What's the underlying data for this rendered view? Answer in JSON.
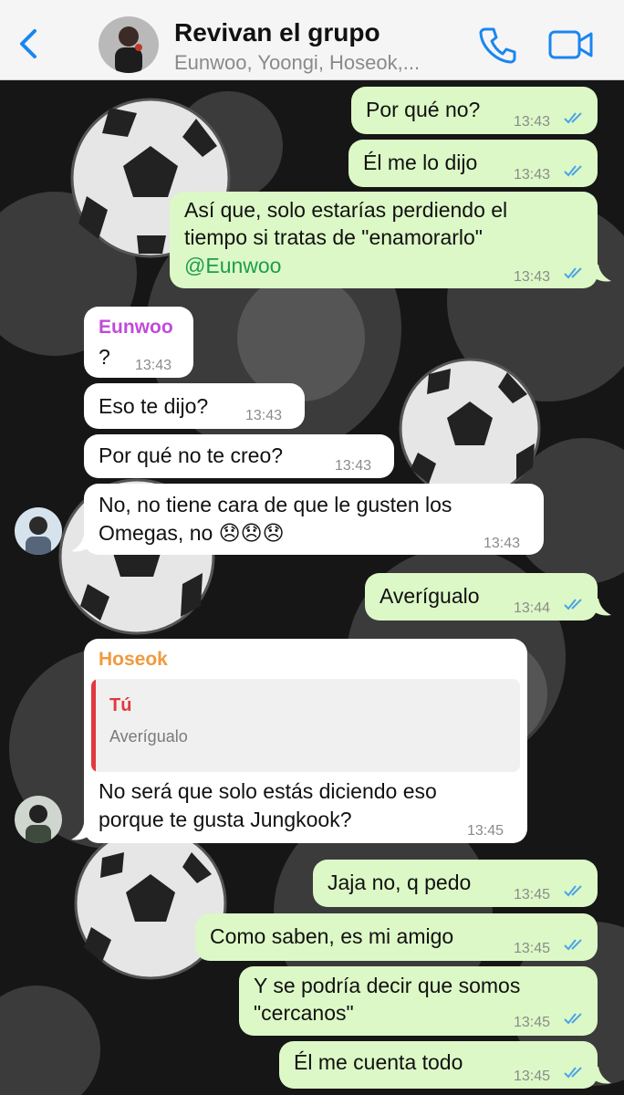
{
  "header": {
    "back_label": "back",
    "title": "Revivan el grupo",
    "subtitle": "Eunwoo, Yoongi, Hoseok,..."
  },
  "messages": [
    {
      "direction": "out",
      "text": "Por qué no?",
      "time": "13:43",
      "status": "read"
    },
    {
      "direction": "out",
      "text": "Él me lo dijo",
      "time": "13:43",
      "status": "read"
    },
    {
      "direction": "out",
      "line1": "Así que, solo estarías perdiendo el",
      "line2": "tiempo si tratas de \"enamorarlo\"",
      "mention": "@Eunwoo",
      "time": "13:43",
      "status": "read"
    },
    {
      "direction": "in",
      "sender": "Eunwoo",
      "text": "?",
      "time": "13:43"
    },
    {
      "direction": "in",
      "text": "Eso te dijo?",
      "time": "13:43"
    },
    {
      "direction": "in",
      "text": "Por qué no te creo?",
      "time": "13:43"
    },
    {
      "direction": "in",
      "line1": "No, no tiene cara de que le gusten los",
      "line2": "Omegas, no 😞😞😞",
      "time": "13:43"
    },
    {
      "direction": "out",
      "text": "Averígualo",
      "time": "13:44",
      "status": "read"
    },
    {
      "direction": "in",
      "sender": "Hoseok",
      "quote_name": "Tú",
      "quote_text": "Averígualo",
      "line1": "No será que solo estás diciendo eso",
      "line2": "porque te gusta Jungkook?",
      "time": "13:45"
    },
    {
      "direction": "out",
      "text": "Jaja no, q pedo",
      "time": "13:45",
      "status": "read"
    },
    {
      "direction": "out",
      "text": "Como saben, es mi amigo",
      "time": "13:45",
      "status": "read"
    },
    {
      "direction": "out",
      "line1": "Y se podría decir que somos",
      "line2": "\"cercanos\"",
      "time": "13:45",
      "status": "read"
    },
    {
      "direction": "out",
      "text": "Él me cuenta todo",
      "time": "13:45",
      "status": "read"
    }
  ],
  "colors": {
    "accent_blue": "#1a86f0",
    "outgoing_bubble": "#dcf8c6",
    "incoming_bubble": "#ffffff",
    "sender_eunwoo": "#c04bd8",
    "sender_hoseok": "#f09a3e",
    "quote_accent": "#e0393e",
    "mention": "#1f9c4d",
    "read_ticks": "#4aa3e6"
  },
  "icons": [
    "chevron-left-icon",
    "phone-icon",
    "video-camera-icon",
    "double-check-icon"
  ]
}
